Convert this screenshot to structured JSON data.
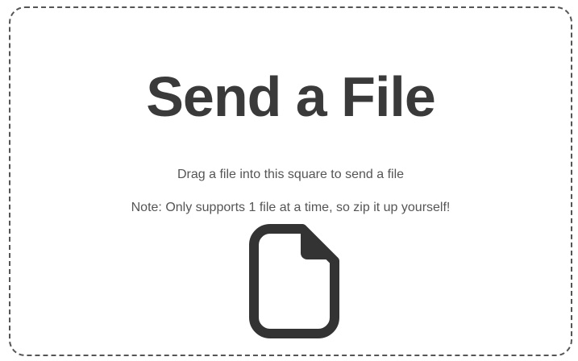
{
  "dropzone": {
    "title": "Send a File",
    "instruction": "Drag a file into this square to send a file",
    "note": "Note: Only supports 1 file at a time, so zip it up yourself!",
    "icon": "file-icon"
  },
  "colors": {
    "text": "#3a3a3a",
    "border": "#555555",
    "background": "#ffffff"
  }
}
